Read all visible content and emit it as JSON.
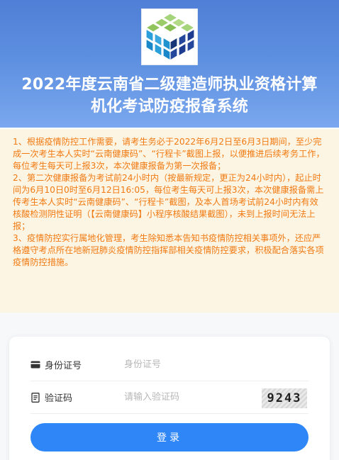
{
  "header": {
    "logo_icon": "isometric-cube-logo-icon",
    "title_line1": "2022年度云南省二级建造师执业资格计算",
    "title_line2": "机化考试防疫报备系统",
    "colors": {
      "bg_top": "#4f7fd6",
      "bg_bottom": "#7aa7ee",
      "title": "#ffffff"
    }
  },
  "notice": {
    "color": "#f07a12",
    "background": "#fdf5e4",
    "items": [
      "1、根据疫情防控工作需要，请考生务必于2022年6月2日至6月3日期间，至少完成一次考生本人实时“云南健康码”、“行程卡”截图上报，以便推进后续考务工作，每位考生每天可上报3次，本次健康报备为第一次报备；",
      "2、第二次健康报备为考试前24小时内（按最新规定，更正为24小时内），起止时间为6月10日0时至6月12日16:05，每位考生每天可上报3次，本次健康报备需上传考生本人实时“云南健康码”、“行程卡”截图，及本人首场考试前24小时内有效核酸检测阴性证明（【云南健康码】小程序核酸结果截图），未到上报时间无法上报；",
      "3、疫情防控实行属地化管理，考生除知悉本告知书疫情防控相关事项外，还应严格遵守考点所在地新冠肺炎疫情防控指挥部相关疫情防控要求，积极配合落实各项疫情防控措施。"
    ]
  },
  "form": {
    "id_icon": "id-card-icon",
    "id_label": "身份证号",
    "id_placeholder": "身份证号",
    "code_icon": "document-icon",
    "code_label": "验证码",
    "code_placeholder": "请输入验证码",
    "captcha_text": "9243",
    "login_label": "登录",
    "accent": "#2f86f6"
  }
}
